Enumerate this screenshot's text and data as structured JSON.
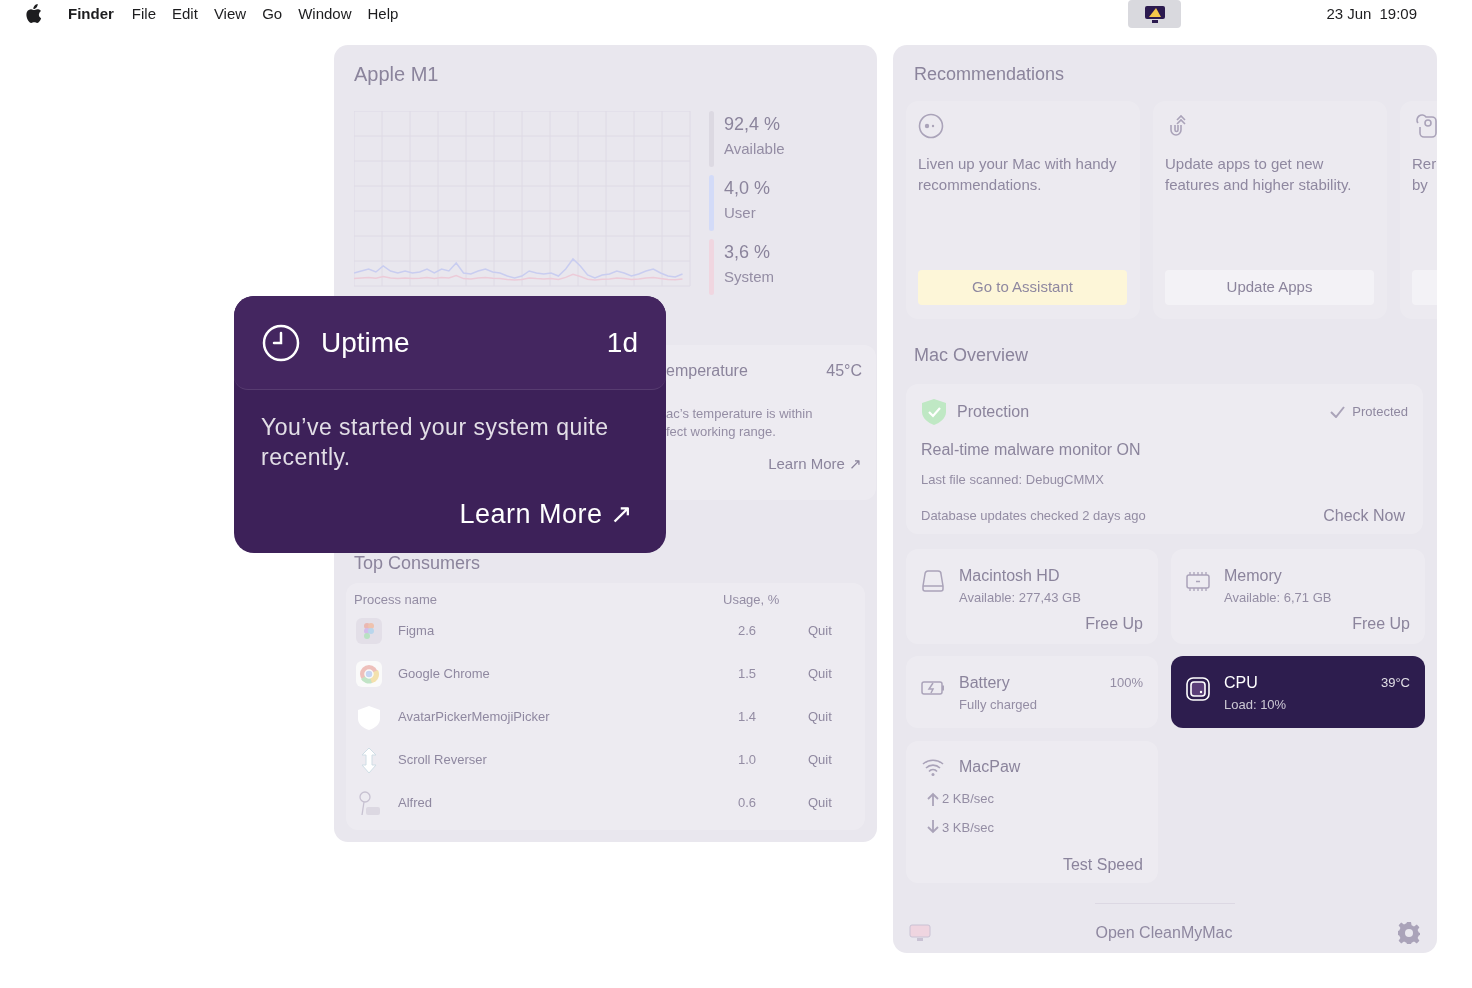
{
  "menu_bar": {
    "menus": [
      {
        "label": "Finder",
        "kind": "app"
      },
      {
        "label": "File",
        "kind": "menu"
      },
      {
        "label": "Edit",
        "kind": "menu"
      },
      {
        "label": "View",
        "kind": "menu"
      },
      {
        "label": "Go",
        "kind": "menu"
      },
      {
        "label": "Window",
        "kind": "menu"
      },
      {
        "label": "Help",
        "kind": "menu"
      }
    ],
    "status_item": {
      "selected": true
    },
    "date": "23 Jun",
    "time": "19:09"
  },
  "cpu_panel": {
    "title": "Apple M1",
    "legend": [
      {
        "value": "92,4 %",
        "label": "Available",
        "color": "#dcd9e2"
      },
      {
        "value": "4,0 %",
        "label": "User",
        "color": "#d3dbf8"
      },
      {
        "value": "3,6 %",
        "label": "System",
        "color": "#f0d6e0"
      }
    ],
    "temperature": {
      "title": "emperature",
      "value": "45°C",
      "lines": [
        "ac’s temperature is within",
        "fect working range."
      ],
      "link": "Learn More ↗"
    },
    "top_consumers": {
      "title": "Top Consumers",
      "columns": [
        "Process name",
        "Usage, %"
      ],
      "rows": [
        {
          "kind": "figma",
          "name": "Figma",
          "usage": "2.6",
          "action": "Quit"
        },
        {
          "kind": "chrome",
          "name": "Google Chrome",
          "usage": "1.5",
          "action": "Quit"
        },
        {
          "kind": "shield",
          "name": "AvatarPickerMemojiPicker",
          "usage": "1.4",
          "action": "Quit"
        },
        {
          "kind": "arrows",
          "name": "Scroll Reverser",
          "usage": "1.0",
          "action": "Quit"
        },
        {
          "kind": "alfred",
          "name": "Alfred",
          "usage": "0.6",
          "action": "Quit"
        }
      ]
    }
  },
  "uptime_popup": {
    "title": "Uptime",
    "value": "1d",
    "text": "You’ve started your system quite recently.",
    "link": "Learn More ↗"
  },
  "recommendations": {
    "title": "Recommendations",
    "cards": [
      {
        "kind": "assistant",
        "text": "Liven up your Mac with handy recommendations.",
        "button": "Go to Assistant"
      },
      {
        "kind": "update",
        "text": "Update apps to get new features and higher stability.",
        "button": "Update Apps"
      },
      {
        "kind": "hand",
        "text": "Rer by"
      }
    ]
  },
  "mac_overview": {
    "title": "Mac Overview",
    "protection": {
      "title": "Protection",
      "status": "Protected",
      "headline": "Real-time malware monitor ON",
      "last_scan": "Last file scanned: DebugCMMX",
      "database": "Database updates checked 2 days ago",
      "action": "Check Now"
    },
    "tiles": [
      {
        "kind": "disk",
        "title": "Macintosh HD",
        "subtitle": "Available: 277,43 GB",
        "action": "Free Up",
        "selected": false
      },
      {
        "kind": "memory",
        "title": "Memory",
        "subtitle": "Available: 6,71 GB",
        "action": "Free Up",
        "selected": false
      },
      {
        "kind": "battery",
        "title": "Battery",
        "subtitle": "Fully charged",
        "value": "100%",
        "selected": false
      },
      {
        "kind": "cpu",
        "title": "CPU",
        "subtitle": "Load: 10%",
        "value": "39°C",
        "selected": true
      }
    ],
    "network": {
      "title": "MacPaw",
      "upload": "2 KB/sec",
      "download": "3 KB/sec",
      "action": "Test Speed"
    }
  },
  "footer": {
    "action": "Open CleanMyMac"
  }
}
